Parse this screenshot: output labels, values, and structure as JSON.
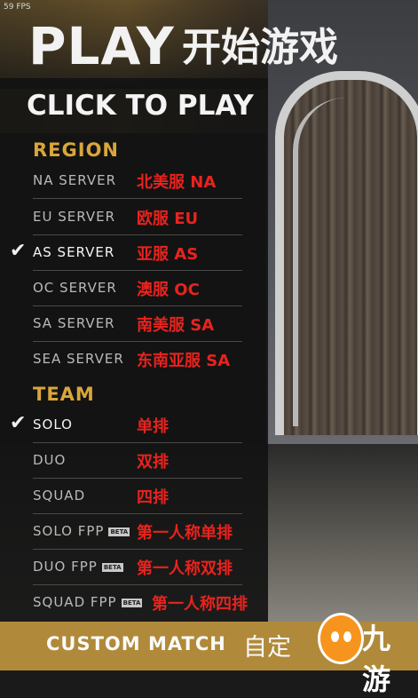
{
  "fps": "59 FPS",
  "title": {
    "play": "PLAY",
    "play_cn": "开始游戏",
    "click": "CLICK TO PLAY"
  },
  "region": {
    "title": "REGION",
    "items": [
      {
        "en": "NA SERVER",
        "cn": "北美服 NA",
        "selected": false
      },
      {
        "en": "EU SERVER",
        "cn": "欧服 EU",
        "selected": false
      },
      {
        "en": "AS SERVER",
        "cn": "亚服 AS",
        "selected": true
      },
      {
        "en": "OC SERVER",
        "cn": "澳服 OC",
        "selected": false
      },
      {
        "en": "SA SERVER",
        "cn": "南美服 SA",
        "selected": false
      },
      {
        "en": "SEA SERVER",
        "cn": "东南亚服 SA",
        "selected": false
      }
    ]
  },
  "team": {
    "title": "TEAM",
    "items": [
      {
        "en": "SOLO",
        "cn": "单排",
        "selected": true
      },
      {
        "en": "DUO",
        "cn": "双排",
        "selected": false
      },
      {
        "en": "SQUAD",
        "cn": "四排",
        "selected": false
      },
      {
        "en": "SOLO FPP",
        "badge": "BETA",
        "cn": "第一人称单排",
        "selected": false
      },
      {
        "en": "DUO FPP",
        "badge": "BETA",
        "cn": "第一人称双排",
        "selected": false
      },
      {
        "en": "SQUAD FPP",
        "badge": "BETA",
        "cn": "第一人称四排",
        "selected": false
      }
    ]
  },
  "custom": {
    "en": "CUSTOM MATCH",
    "cn": "自定"
  },
  "watermark": {
    "text": "九游"
  },
  "colors": {
    "accent": "#d9a63a",
    "cn_label": "#e8231e",
    "custom_bar": "#b08a3a"
  }
}
